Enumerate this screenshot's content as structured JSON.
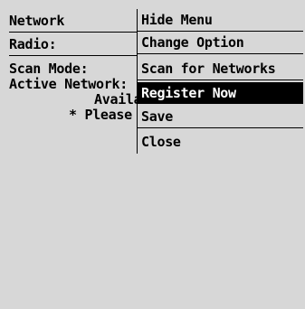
{
  "screen": {
    "title": "Network",
    "radio_label": "Radio:",
    "scan_mode_label": "Scan Mode:",
    "active_network_label": "Active Network:",
    "available_fragment": "Availab",
    "please_fragment": "* Please"
  },
  "menu": {
    "items": [
      {
        "label": "Hide Menu"
      },
      {
        "label": "Change Option"
      },
      {
        "label": "Scan for Networks"
      },
      {
        "label": "Register Now"
      },
      {
        "label": "Save"
      },
      {
        "label": "Close"
      }
    ],
    "selected_index": 3
  },
  "colors": {
    "background": "#d7d7d7",
    "selected_bg": "#000000",
    "selected_fg": "#ffffff"
  }
}
